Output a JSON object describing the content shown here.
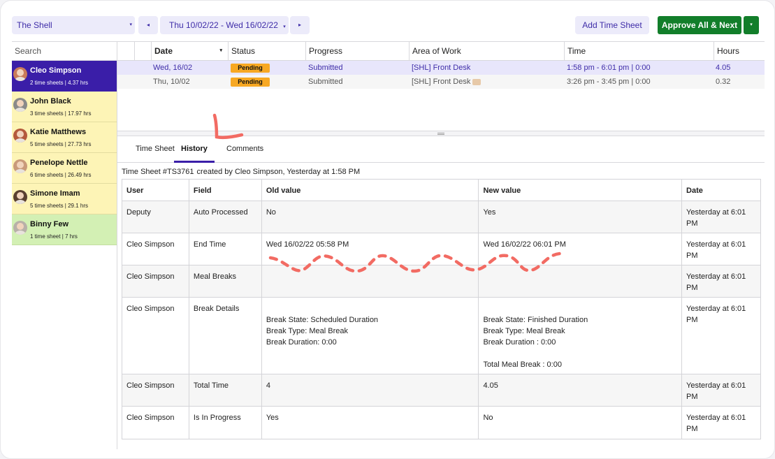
{
  "toolbar": {
    "location": "The Shell",
    "prev_icon": "◂",
    "date_range": "Thu 10/02/22 - Wed 16/02/22",
    "next_icon": "▸",
    "add_timesheet": "Add Time Sheet",
    "approve_all": "Approve All & Next",
    "dropdown_caret": "▾"
  },
  "sidebar": {
    "search_placeholder": "Search",
    "employees": [
      {
        "name": "Cleo Simpson",
        "stats": "2 time sheets | 4.37 hrs",
        "state": "active",
        "avatar_color": "#c97b5a"
      },
      {
        "name": "John Black",
        "stats": "3 time sheets | 17.97 hrs",
        "state": "pending",
        "avatar_color": "#8a8a8a"
      },
      {
        "name": "Katie Matthews",
        "stats": "5 time sheets | 27.73 hrs",
        "state": "pending",
        "avatar_color": "#b45a3c"
      },
      {
        "name": "Penelope Nettle",
        "stats": "6 time sheets | 26.49 hrs",
        "state": "pending",
        "avatar_color": "#c99a7a"
      },
      {
        "name": "Simone Imam",
        "stats": "5 time sheets | 29.1 hrs",
        "state": "pending",
        "avatar_color": "#5a4030"
      },
      {
        "name": "Binny Few",
        "stats": "1 time sheet | 7 hrs",
        "state": "approved",
        "avatar_color": "#b8b0a8"
      }
    ]
  },
  "timesheet_list": {
    "columns": [
      "Date",
      "Status",
      "Progress",
      "Area of Work",
      "Time",
      "Hours"
    ],
    "sort_icon": "▾",
    "rows": [
      {
        "date": "Wed, 16/02",
        "status": "Pending",
        "progress": "Submitted",
        "area": "[SHL] Front Desk",
        "time": "1:58 pm - 6:01 pm | 0:00",
        "hours": "4.05",
        "selected": true
      },
      {
        "date": "Thu, 10/02",
        "status": "Pending",
        "progress": "Submitted",
        "area": "[SHL] Front Desk",
        "time": "3:26 pm - 3:45 pm | 0:00",
        "hours": "0.32",
        "selected": false
      }
    ]
  },
  "tabs": [
    "Time Sheet",
    "History",
    "Comments"
  ],
  "active_tab": "History",
  "history": {
    "timesheet_id": "Time Sheet #TS3761",
    "created_by": "created by Cleo Simpson, Yesterday at 1:58 PM",
    "columns": [
      "User",
      "Field",
      "Old value",
      "New value",
      "Date"
    ],
    "rows": [
      {
        "user": "Deputy",
        "field": "Auto Processed",
        "old": "No",
        "new": "Yes",
        "date": "Yesterday at 6:01 PM"
      },
      {
        "user": "Cleo Simpson",
        "field": "End Time",
        "old": "Wed 16/02/22 05:58 PM",
        "new": "Wed 16/02/22 06:01 PM",
        "date": "Yesterday at 6:01 PM"
      },
      {
        "user": "Cleo Simpson",
        "field": "Meal Breaks",
        "old": "",
        "new": "",
        "date": "Yesterday at 6:01 PM"
      },
      {
        "user": "Cleo Simpson",
        "field": "Break Details",
        "old": "\nBreak State: Scheduled Duration\nBreak Type: Meal Break\nBreak Duration: 0:00",
        "new": "\nBreak State: Finished Duration\nBreak Type: Meal Break\nBreak Duration : 0:00\n\nTotal Meal Break : 0:00",
        "date": "Yesterday at 6:01 PM"
      },
      {
        "user": "Cleo Simpson",
        "field": "Total Time",
        "old": "4",
        "new": "4.05",
        "date": "Yesterday at 6:01 PM"
      },
      {
        "user": "Cleo Simpson",
        "field": "Is In Progress",
        "old": "Yes",
        "new": "No",
        "date": "Yesterday at 6:01 PM"
      }
    ]
  },
  "colors": {
    "brand": "#3a1ea8",
    "approve": "#127e2a",
    "pending_badge": "#f7a823",
    "annotation": "#f26b63"
  }
}
